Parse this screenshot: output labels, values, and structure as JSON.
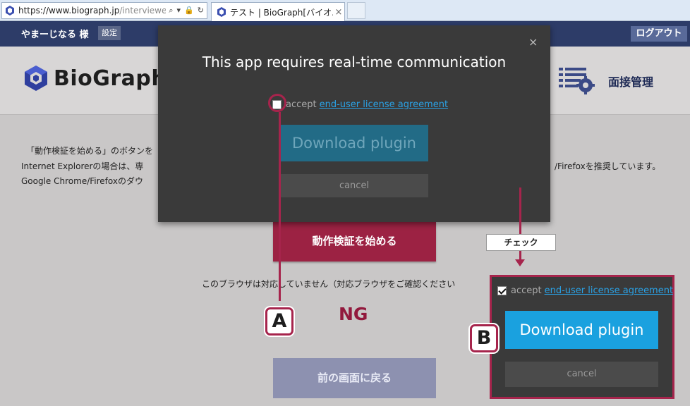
{
  "browser": {
    "url_prefix": "https://www.biograph.jp",
    "url_rest": "/interviewe",
    "tab_title": "テスト | BioGraph[バイオ...",
    "tab_close": "×"
  },
  "header": {
    "user": "やまーじなる 様",
    "settings": "設定",
    "logout": "ログアウト",
    "logo_text": "BioGraph",
    "menu_label": "面接管理"
  },
  "body": {
    "line1": "「動作検証を始める」のボタンを",
    "line2": "Internet Explorerの場合は、専",
    "line2_right": "/Firefoxを推奨しています。",
    "line3": "Google Chrome/Firefoxのダウ",
    "start_button": "動作検証を始める",
    "unsupported": "このブラウザは対応していません（対応ブラウザをご確認ください",
    "result": "NG",
    "back_button": "前の画面に戻る"
  },
  "modal": {
    "title": "This app requires real-time communication",
    "accept": "accept",
    "link": "end-user license agreement",
    "download": "Download plugin",
    "cancel": "cancel",
    "close": "×"
  },
  "annotation": {
    "label_a": "A",
    "label_b": "B",
    "check_label": "チェック",
    "accent_color": "#a6244c"
  },
  "zoom": {
    "accept": "accept",
    "link": "end-user license agreement",
    "download": "Download plugin",
    "cancel": "cancel",
    "checked": true
  }
}
